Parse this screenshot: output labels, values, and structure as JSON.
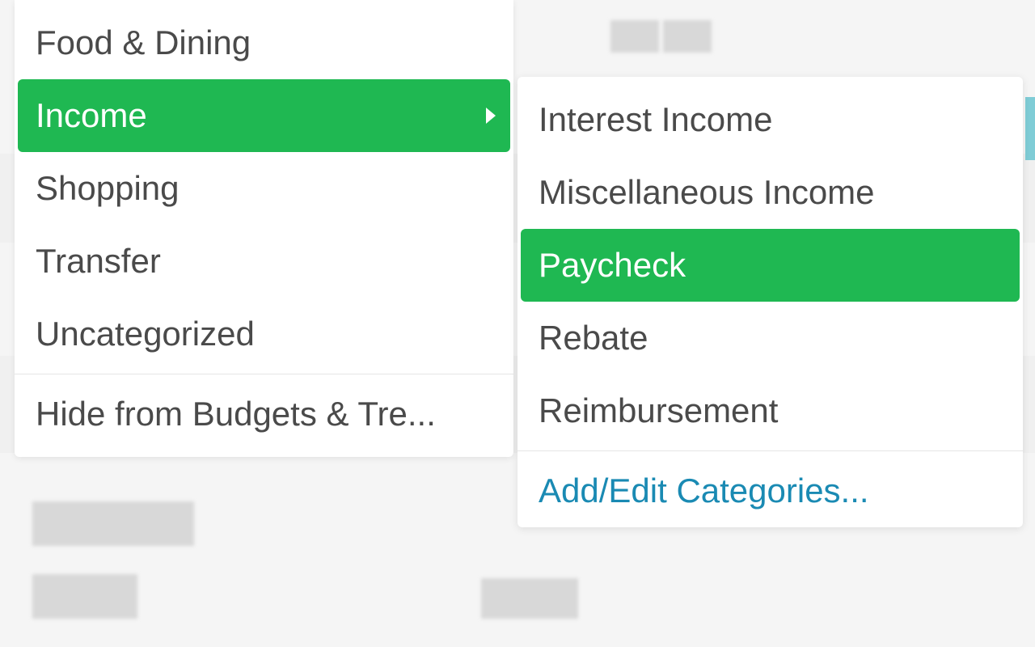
{
  "primaryMenu": {
    "items": [
      {
        "label": "Food & Dining",
        "selected": false
      },
      {
        "label": "Income",
        "selected": true,
        "hasSubmenu": true
      },
      {
        "label": "Shopping",
        "selected": false
      },
      {
        "label": "Transfer",
        "selected": false
      },
      {
        "label": "Uncategorized",
        "selected": false
      }
    ],
    "footerLabel": "Hide from Budgets & Tre..."
  },
  "secondaryMenu": {
    "items": [
      {
        "label": "Interest Income",
        "selected": false
      },
      {
        "label": "Miscellaneous Income",
        "selected": false
      },
      {
        "label": "Paycheck",
        "selected": true
      },
      {
        "label": "Rebate",
        "selected": false
      },
      {
        "label": "Reimbursement",
        "selected": false
      }
    ],
    "footerLabel": "Add/Edit Categories..."
  },
  "colors": {
    "accent": "#1fb852",
    "link": "#1a8ab3"
  }
}
